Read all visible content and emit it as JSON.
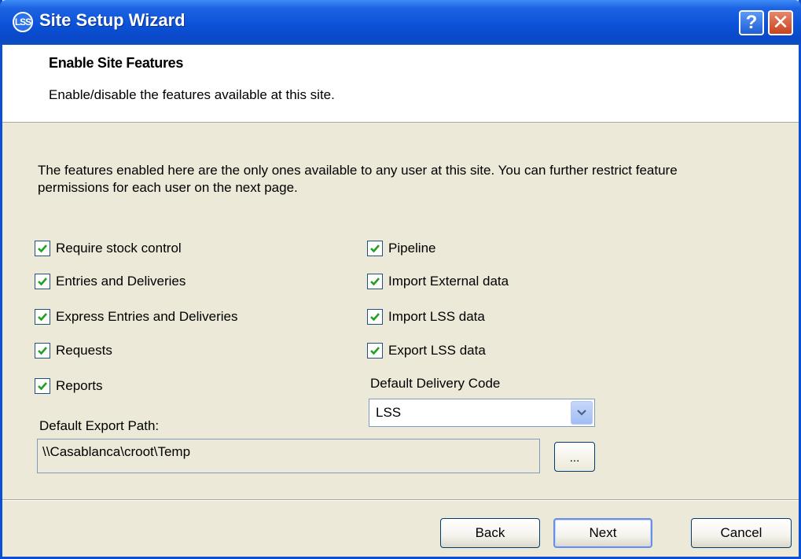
{
  "window": {
    "title": "Site Setup Wizard",
    "app_icon": "LSS",
    "help_label": "?",
    "close_label": "✕"
  },
  "header": {
    "title": "Enable Site Features",
    "subtitle": "Enable/disable the features available at this site."
  },
  "intro_text": "The features enabled here are the only ones available to any user at this site. You can further restrict feature permissions for each user on the next page.",
  "features_left": [
    {
      "label": "Require stock control",
      "checked": true
    },
    {
      "label": "Entries and Deliveries",
      "checked": true
    },
    {
      "label": "Express Entries and Deliveries",
      "checked": true
    },
    {
      "label": "Requests",
      "checked": true
    },
    {
      "label": "Reports",
      "checked": true
    }
  ],
  "features_right": [
    {
      "label": "Pipeline",
      "checked": true
    },
    {
      "label": "Import External data",
      "checked": true
    },
    {
      "label": "Import LSS data",
      "checked": true
    },
    {
      "label": "Export LSS data",
      "checked": true
    }
  ],
  "delivery_code": {
    "label": "Default Delivery Code",
    "value": "LSS"
  },
  "export_path": {
    "label": "Default Export Path:",
    "value": "\\\\Casablanca\\croot\\Temp",
    "browse_label": "..."
  },
  "buttons": {
    "back": "Back",
    "next": "Next",
    "cancel": "Cancel"
  },
  "colors": {
    "titlebar": "#0b52d8",
    "dialog_bg": "#ece9d8",
    "check": "#21a121"
  }
}
